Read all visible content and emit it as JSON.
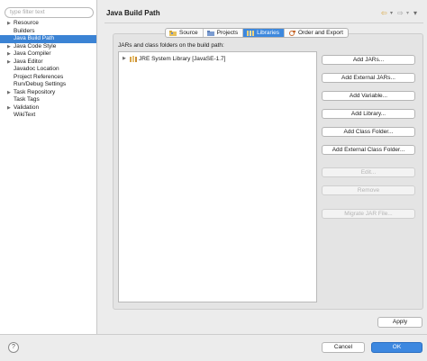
{
  "sidebar": {
    "filter_placeholder": "type filter text",
    "items": [
      {
        "label": "Resource",
        "expandable": true
      },
      {
        "label": "Builders",
        "expandable": false
      },
      {
        "label": "Java Build Path",
        "expandable": false,
        "selected": true
      },
      {
        "label": "Java Code Style",
        "expandable": true
      },
      {
        "label": "Java Compiler",
        "expandable": true
      },
      {
        "label": "Java Editor",
        "expandable": true
      },
      {
        "label": "Javadoc Location",
        "expandable": false
      },
      {
        "label": "Project References",
        "expandable": false
      },
      {
        "label": "Run/Debug Settings",
        "expandable": false
      },
      {
        "label": "Task Repository",
        "expandable": true
      },
      {
        "label": "Task Tags",
        "expandable": false
      },
      {
        "label": "Validation",
        "expandable": true
      },
      {
        "label": "WikiText",
        "expandable": false
      }
    ]
  },
  "header": {
    "title": "Java Build Path",
    "back_icon": "back-arrow-icon",
    "forward_icon": "forward-arrow-icon",
    "menu_icon": "view-menu-icon"
  },
  "tabs": [
    {
      "label": "Source",
      "icon": "source-folder-icon",
      "active": false
    },
    {
      "label": "Projects",
      "icon": "projects-icon",
      "active": false
    },
    {
      "label": "Libraries",
      "icon": "libraries-icon",
      "active": true
    },
    {
      "label": "Order and Export",
      "icon": "order-export-icon",
      "active": false
    }
  ],
  "libraries": {
    "caption": "JARs and class folders on the build path:",
    "entries": [
      {
        "label": "JRE System Library [JavaSE-1.7]",
        "icon": "jre-library-icon"
      }
    ]
  },
  "buttons": {
    "add_jars": "Add JARs...",
    "add_external_jars": "Add External JARs...",
    "add_variable": "Add Variable...",
    "add_library": "Add Library...",
    "add_class_folder": "Add Class Folder...",
    "add_external_class_folder": "Add External Class Folder...",
    "edit": "Edit...",
    "remove": "Remove",
    "migrate_jar": "Migrate JAR File..."
  },
  "footer": {
    "apply": "Apply",
    "cancel": "Cancel",
    "ok": "OK",
    "help_symbol": "?"
  },
  "colors": {
    "accent": "#3b83d4",
    "ok_button": "#3d88e0"
  }
}
